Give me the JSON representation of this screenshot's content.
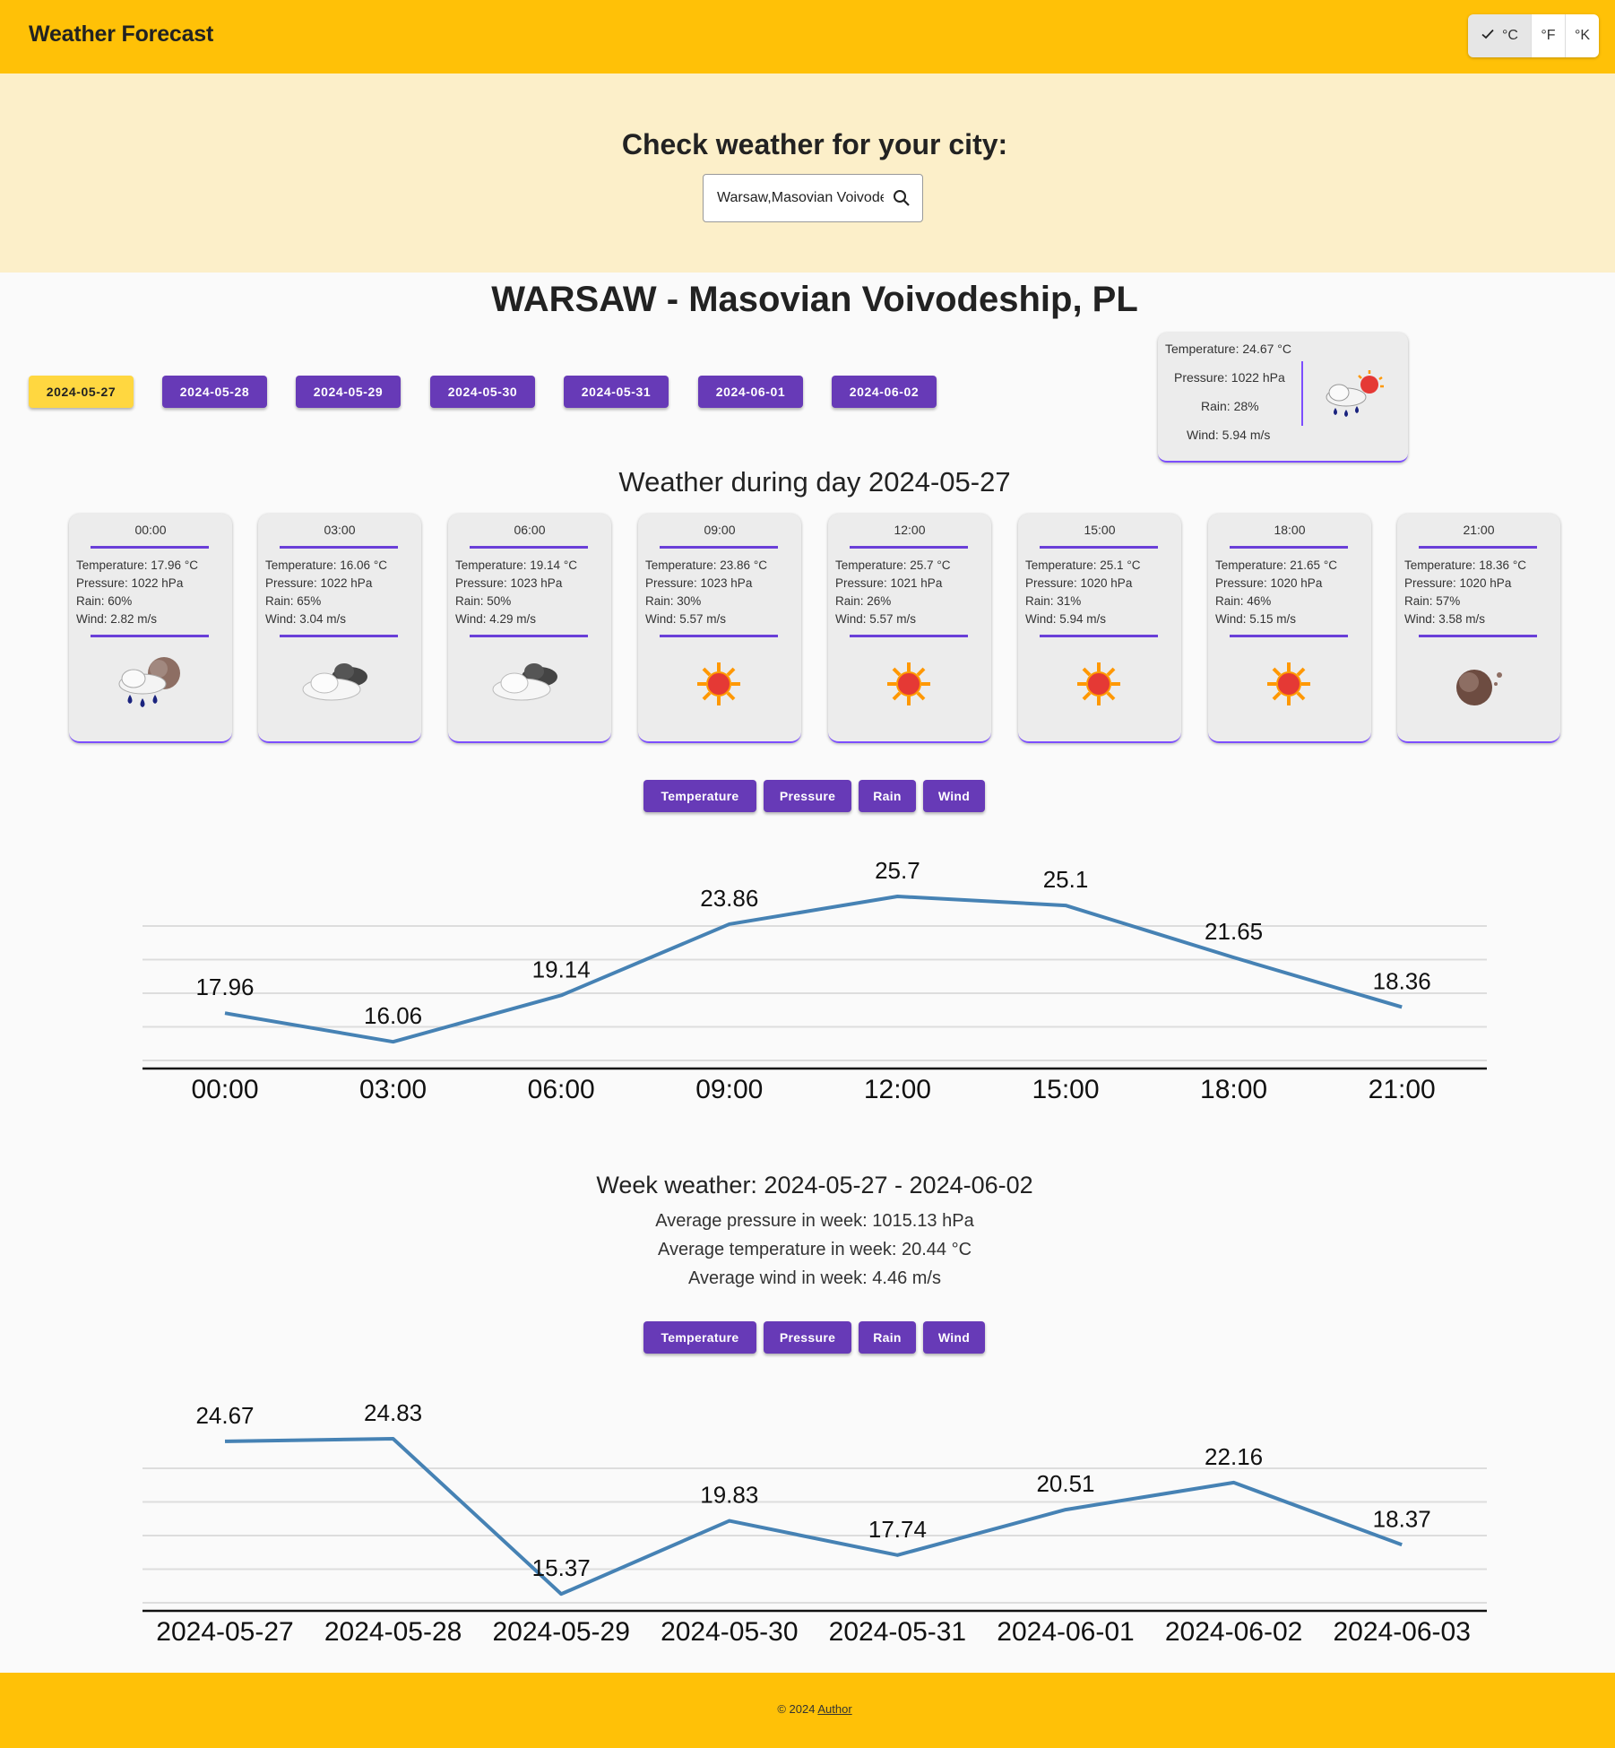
{
  "header": {
    "title": "Weather Forecast",
    "units": [
      {
        "label": "°C",
        "selected": true
      },
      {
        "label": "°F",
        "selected": false
      },
      {
        "label": "°K",
        "selected": false
      }
    ]
  },
  "search": {
    "heading": "Check weather for your city:",
    "value": "Warsaw,Masovian Voivodeship,PL",
    "icon": "search-icon"
  },
  "city": {
    "title": "WARSAW - Masovian Voivodeship, PL"
  },
  "dates": [
    "2024-05-27",
    "2024-05-28",
    "2024-05-29",
    "2024-05-30",
    "2024-05-31",
    "2024-06-01",
    "2024-06-02"
  ],
  "current": {
    "temperature": "Temperature: 24.67 °C",
    "pressure": "Pressure: 1022 hPa",
    "rain": "Rain: 28%",
    "wind": "Wind: 5.94 m/s",
    "icon": "rain-sun-icon"
  },
  "day": {
    "title": "Weather during day 2024-05-27",
    "hours": [
      {
        "time": "00:00",
        "temperature": "Temperature: 17.96 °C",
        "pressure": "Pressure: 1022 hPa",
        "rain": "Rain: 60%",
        "wind": "Wind: 2.82 m/s",
        "icon": "rain-moon-icon"
      },
      {
        "time": "03:00",
        "temperature": "Temperature: 16.06 °C",
        "pressure": "Pressure: 1022 hPa",
        "rain": "Rain: 65%",
        "wind": "Wind: 3.04 m/s",
        "icon": "cloud-icon"
      },
      {
        "time": "06:00",
        "temperature": "Temperature: 19.14 °C",
        "pressure": "Pressure: 1023 hPa",
        "rain": "Rain: 50%",
        "wind": "Wind: 4.29 m/s",
        "icon": "cloud-icon"
      },
      {
        "time": "09:00",
        "temperature": "Temperature: 23.86 °C",
        "pressure": "Pressure: 1023 hPa",
        "rain": "Rain: 30%",
        "wind": "Wind: 5.57 m/s",
        "icon": "sun-icon"
      },
      {
        "time": "12:00",
        "temperature": "Temperature: 25.7 °C",
        "pressure": "Pressure: 1021 hPa",
        "rain": "Rain: 26%",
        "wind": "Wind: 5.57 m/s",
        "icon": "sun-icon"
      },
      {
        "time": "15:00",
        "temperature": "Temperature: 25.1 °C",
        "pressure": "Pressure: 1020 hPa",
        "rain": "Rain: 31%",
        "wind": "Wind: 5.94 m/s",
        "icon": "sun-icon"
      },
      {
        "time": "18:00",
        "temperature": "Temperature: 21.65 °C",
        "pressure": "Pressure: 1020 hPa",
        "rain": "Rain: 46%",
        "wind": "Wind: 5.15 m/s",
        "icon": "sun-icon"
      },
      {
        "time": "21:00",
        "temperature": "Temperature: 18.36 °C",
        "pressure": "Pressure: 1020 hPa",
        "rain": "Rain: 57%",
        "wind": "Wind: 3.58 m/s",
        "icon": "moon-icon"
      }
    ],
    "buttons": [
      "Temperature",
      "Pressure",
      "Rain",
      "Wind"
    ]
  },
  "week": {
    "title": "Week weather: 2024-05-27 - 2024-06-02",
    "avg_pressure": "Average pressure in week: 1015.13 hPa",
    "avg_temperature": "Average temperature in week: 20.44 °C",
    "avg_wind": "Average wind in week: 4.46 m/s",
    "buttons": [
      "Temperature",
      "Pressure",
      "Rain",
      "Wind"
    ]
  },
  "colors": {
    "header": "#ffc107",
    "search_bg": "#fcefc9",
    "primary": "#673ab7",
    "active_date": "#ffd740",
    "line": "#4682b4"
  },
  "footer": {
    "prefix": "© 2024 ",
    "author": "Author"
  },
  "chart_data": [
    {
      "type": "line",
      "categories": [
        "00:00",
        "03:00",
        "06:00",
        "09:00",
        "12:00",
        "15:00",
        "18:00",
        "21:00"
      ],
      "values": [
        17.96,
        16.06,
        19.14,
        23.86,
        25.7,
        25.1,
        21.65,
        18.36
      ],
      "data_labels": [
        "17.96",
        "16.06",
        "19.14",
        "23.86",
        "25.7",
        "25.1",
        "21.65",
        "18.36"
      ],
      "ylim": [
        15,
        25.7
      ],
      "grid": true,
      "legend": "none"
    },
    {
      "type": "line",
      "categories": [
        "2024-05-27",
        "2024-05-28",
        "2024-05-29",
        "2024-05-30",
        "2024-05-31",
        "2024-06-01",
        "2024-06-02",
        "2024-06-03"
      ],
      "values": [
        24.67,
        24.83,
        15.37,
        19.83,
        17.74,
        20.51,
        22.16,
        18.37
      ],
      "data_labels": [
        "24.67",
        "24.83",
        "15.37",
        "19.83",
        "17.74",
        "20.51",
        "22.16",
        "18.37"
      ],
      "ylim": [
        15,
        24.83
      ],
      "grid": true,
      "legend": "none"
    }
  ]
}
